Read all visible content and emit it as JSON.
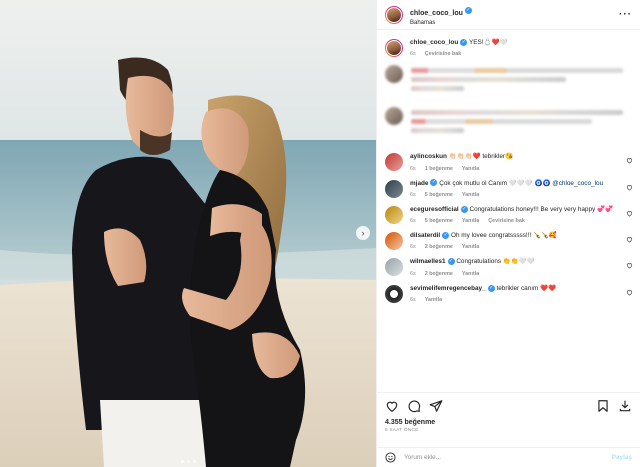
{
  "header": {
    "username": "chloe_coco_lou",
    "location": "Bahamas",
    "more_icon": "ellipsis-icon"
  },
  "caption": {
    "username": "chloe_coco_lou",
    "text": "YES!💍❤️🤍",
    "translate": "Çevirisine bak"
  },
  "comments": [
    {
      "username": "aylincoskun",
      "text": "👏🏻👏🏻👏🏻❤️ tebrikler😘",
      "likes": "1 beğenme",
      "reply": "Yanıtla",
      "translate": ""
    },
    {
      "username": "mjade",
      "text": "Çok çok mutlu ol Canım 🤍🤍🤍 🧿🧿",
      "mention": "@chloe_coco_lou",
      "likes": "5 beğenme",
      "reply": "Yanıtla",
      "translate": ""
    },
    {
      "username": "eceguresofficial",
      "text": "Congratulations honey!!! Be very very happy 💞💞",
      "likes": "5 beğenme",
      "reply": "Yanıtla",
      "translate": "Çevirisine bak"
    },
    {
      "username": "dilsaterdil",
      "text": "Oh my lovee congratsssss!!! 🍾🍾🥰",
      "likes": "2 beğenme",
      "reply": "Yanıtla",
      "translate": ""
    },
    {
      "username": "wilmaelles1",
      "text": "Congratulations 👏👏🤍🤍",
      "likes": "2 beğenme",
      "reply": "Yanıtla",
      "translate": ""
    },
    {
      "username": "sevimelifemregencebay_",
      "text": "tebrikler canım ❤️❤️",
      "likes": "",
      "reply": "Yanıtla",
      "translate": ""
    }
  ],
  "actions": {
    "like_icon": "heart-icon",
    "comment_icon": "comment-icon",
    "share_icon": "share-icon",
    "save_icon": "bookmark-icon",
    "download_icon": "download-icon",
    "likes": "4.355 beğenme",
    "time": "6 SAAT ÖNCE"
  },
  "add_comment": {
    "placeholder": "Yorum ekle...",
    "post": "Paylaş"
  },
  "colors": {
    "verified": "#3897f0",
    "mention": "#00376b",
    "meta": "#8e8e8e",
    "post_disabled": "#b2dffc"
  }
}
